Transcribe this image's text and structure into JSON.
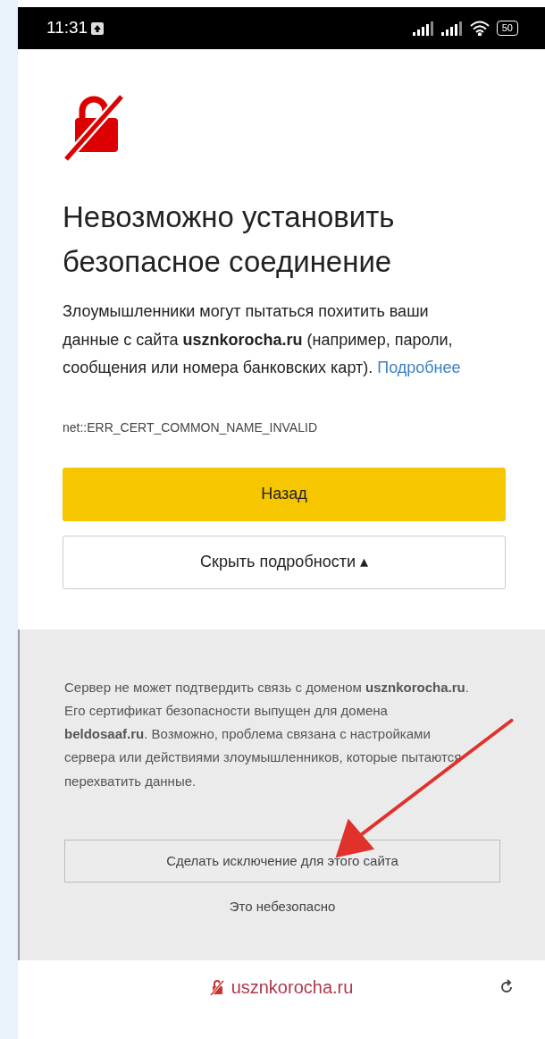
{
  "status_bar": {
    "time": "11:31",
    "battery": "50"
  },
  "error_page": {
    "title": "Невозможно установить безопасное соединение",
    "description": "Злоумышленники могут пытаться похитить ваши данные с сайта **usznkorocha.ru** (например, пароли, сообщения или номера банковских карт).",
    "learn_more_link": "Подробнее",
    "error_code": "net::ERR_CERT_COMMON_NAME_INVALID",
    "back_button": "Назад",
    "details_button": {
      "label": "Скрыть подробности",
      "caret": "▴",
      "expanded": true
    }
  },
  "details": {
    "text": "Сервер не может подтвердить связь с доменом **usznkorocha.ru**. Его сертификат безопасности выпущен для домена **beldosaaf.ru**. Возможно, проблема связана с настройками сервера или действиями злоумышленников, которые пытаются перехватить данные.",
    "exception_button": "Сделать исключение для этого сайта",
    "warning": "Это небезопасно"
  },
  "address_bar": {
    "url": "usznkorocha.ru"
  }
}
